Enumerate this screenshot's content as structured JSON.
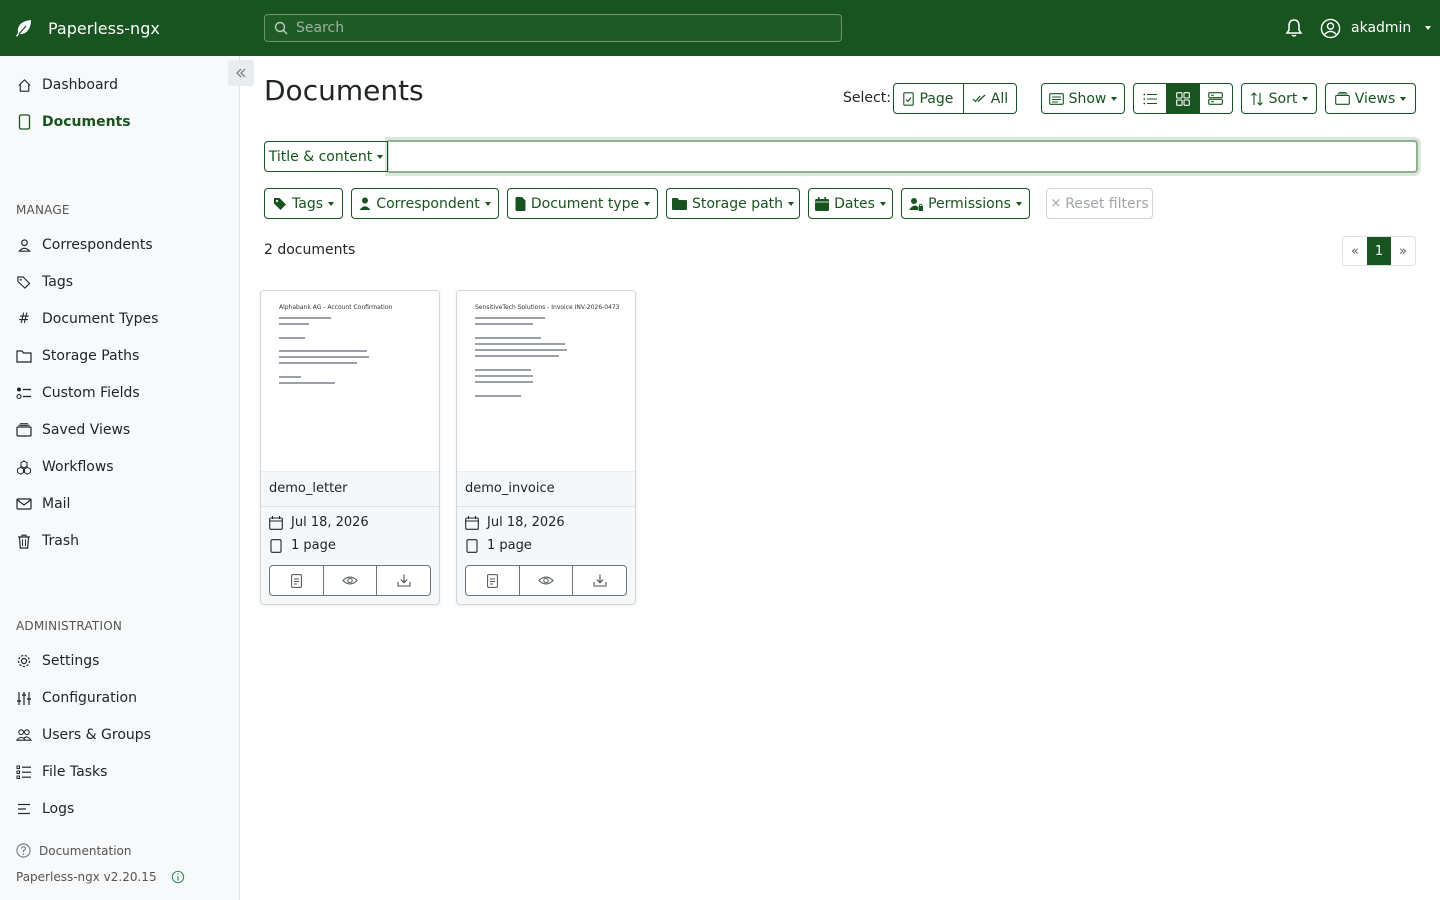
{
  "app": {
    "name": "Paperless-ngx",
    "version_label": "Paperless-ngx v2.20.15"
  },
  "topbar": {
    "search_placeholder": "Search",
    "user": "akadmin"
  },
  "sidebar": {
    "main": [
      {
        "label": "Dashboard",
        "icon": "house-icon"
      },
      {
        "label": "Documents",
        "icon": "file-icon",
        "active": true
      }
    ],
    "manage_heading": "MANAGE",
    "manage": [
      {
        "label": "Correspondents",
        "icon": "person-icon"
      },
      {
        "label": "Tags",
        "icon": "tags-icon"
      },
      {
        "label": "Document Types",
        "icon": "hash-icon"
      },
      {
        "label": "Storage Paths",
        "icon": "folder-icon"
      },
      {
        "label": "Custom Fields",
        "icon": "ui-radios-icon"
      },
      {
        "label": "Saved Views",
        "icon": "collection-icon"
      },
      {
        "label": "Workflows",
        "icon": "boxes-icon"
      },
      {
        "label": "Mail",
        "icon": "envelope-icon"
      },
      {
        "label": "Trash",
        "icon": "trash-icon"
      }
    ],
    "admin_heading": "ADMINISTRATION",
    "admin": [
      {
        "label": "Settings",
        "icon": "gear-icon"
      },
      {
        "label": "Configuration",
        "icon": "sliders-icon"
      },
      {
        "label": "Users & Groups",
        "icon": "people-icon"
      },
      {
        "label": "File Tasks",
        "icon": "list-task-icon"
      },
      {
        "label": "Logs",
        "icon": "text-left-icon"
      }
    ],
    "documentation": "Documentation"
  },
  "page": {
    "title": "Documents",
    "select_label": "Select:",
    "select_page": "Page",
    "select_all": "All",
    "show": "Show",
    "sort": "Sort",
    "views": "Views",
    "view_mode": "small-cards",
    "query_type": "Title & content",
    "query_value": ""
  },
  "filters": {
    "tags": "Tags",
    "correspondent": "Correspondent",
    "document_type": "Document type",
    "storage_path": "Storage path",
    "dates": "Dates",
    "permissions": "Permissions",
    "reset": "Reset filters"
  },
  "results": {
    "count": "2 documents",
    "prev": "«",
    "page": "1",
    "next": "»"
  },
  "documents": [
    {
      "title": "demo_letter",
      "date": "Jul 18, 2026",
      "pages": "1 page",
      "thumb_heading": "Alphabank AG - Account Confirmation"
    },
    {
      "title": "demo_invoice",
      "date": "Jul 18, 2026",
      "pages": "1 page",
      "thumb_heading": "SensitiveTech Solutions - Invoice INV-2026-0473"
    }
  ],
  "colors": {
    "primary": "#17541f",
    "sidebar_bg": "#f8f9fa"
  }
}
